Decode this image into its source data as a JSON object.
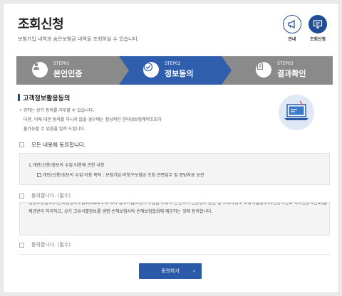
{
  "header": {
    "title": "조회신청",
    "subtitle": "보험가입 내역과 숨은보험금 내역을 조회하실 수 있습니다.",
    "guide_label": "안내",
    "inquiry_label": "조회신청"
  },
  "steps": [
    {
      "num": "STEP01",
      "name": "본인인증",
      "active": false
    },
    {
      "num": "STEP02",
      "name": "정보동의",
      "active": true
    },
    {
      "num": "STEP03",
      "name": "결과확인",
      "active": false
    }
  ],
  "consent": {
    "section_title": "고객정보활용동의",
    "notes": [
      "• 귀하는 상기 동의를 거부할 수 있습니다.",
      "다만, 이에 대한 동의를 하시지 않을 경우에는 정상적인 인터넷보험계약조회가",
      "불가능할 수 있음을 알려 드립니다."
    ],
    "agree_all": "모든 내용에 동의합니다.",
    "box1_line1": "1.개인(신용)정보의 수집.이용에 관한 사항",
    "box1_line2": "개인(신용)정보의 수집·이용 목적 : 보험가입·미청구보험금 조회 관련업무 및 증빙자료 보관",
    "agree1": "동의합니다. (필수)",
    "box2_text": "생성도청정보(기관회정정보모정회)제22조에 따라 정보가입/미청구보험금 조회와 관련하여 신용정보 본인 및 조회자정보 고유식별정보(주민등록번호·외국인등록번호)를 제공받아 처리하고, 상기 고유식별정보를 생명·손해보험사와 손해보험협회에 제공하는 것에 동의합니다.",
    "agree2": "동의합니다. (필수)",
    "submit_label": "동의하기",
    "submit_arrow": "›"
  },
  "colors": {
    "step_inactive": "#8a8a8a",
    "step_active": "#2f5fac",
    "brand": "#1f4e96"
  },
  "icons": {
    "guide": "megaphone-icon",
    "inquiry": "monitor-icon",
    "step1": "person-icon",
    "step2": "check-circle-icon",
    "step3": "document-icon"
  }
}
